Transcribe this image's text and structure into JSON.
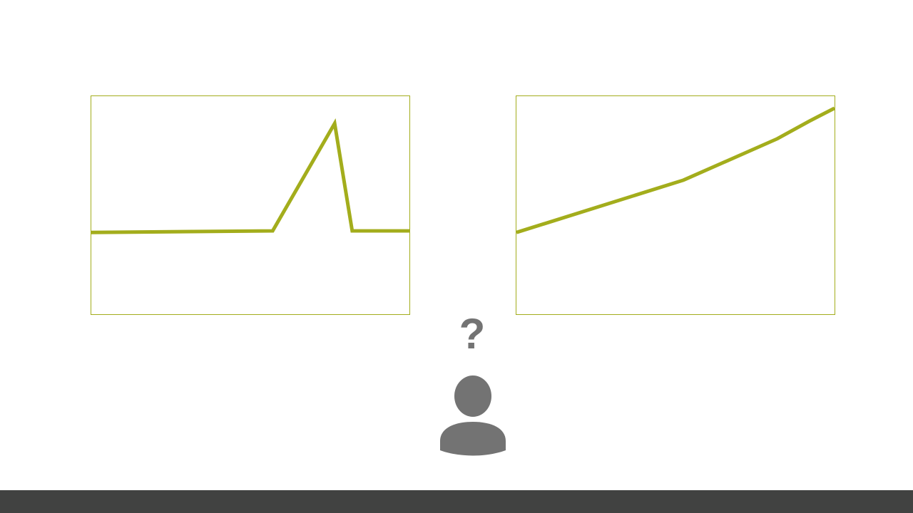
{
  "theme": {
    "accent": "#a3ad1c",
    "icon": "#737373",
    "footer": "#414241"
  },
  "question_mark": "?",
  "person_icon": "person-icon",
  "chart_data": [
    {
      "type": "line",
      "title": "",
      "xlabel": "",
      "ylabel": "",
      "grid": false,
      "xlim": [
        0,
        100
      ],
      "ylim": [
        0,
        100
      ],
      "series": [
        {
          "x": [
            0,
            57,
            76.5,
            82,
            100
          ],
          "values": [
            37.5,
            38.2,
            87.5,
            38.2,
            38.2
          ]
        }
      ]
    },
    {
      "type": "line",
      "title": "",
      "xlabel": "",
      "ylabel": "",
      "grid": false,
      "xlim": [
        0,
        100
      ],
      "ylim": [
        0,
        100
      ],
      "series": [
        {
          "x": [
            0,
            52.5,
            82,
            92,
            100
          ],
          "values": [
            37.5,
            61.5,
            80.5,
            88.5,
            94.5
          ]
        }
      ]
    }
  ]
}
